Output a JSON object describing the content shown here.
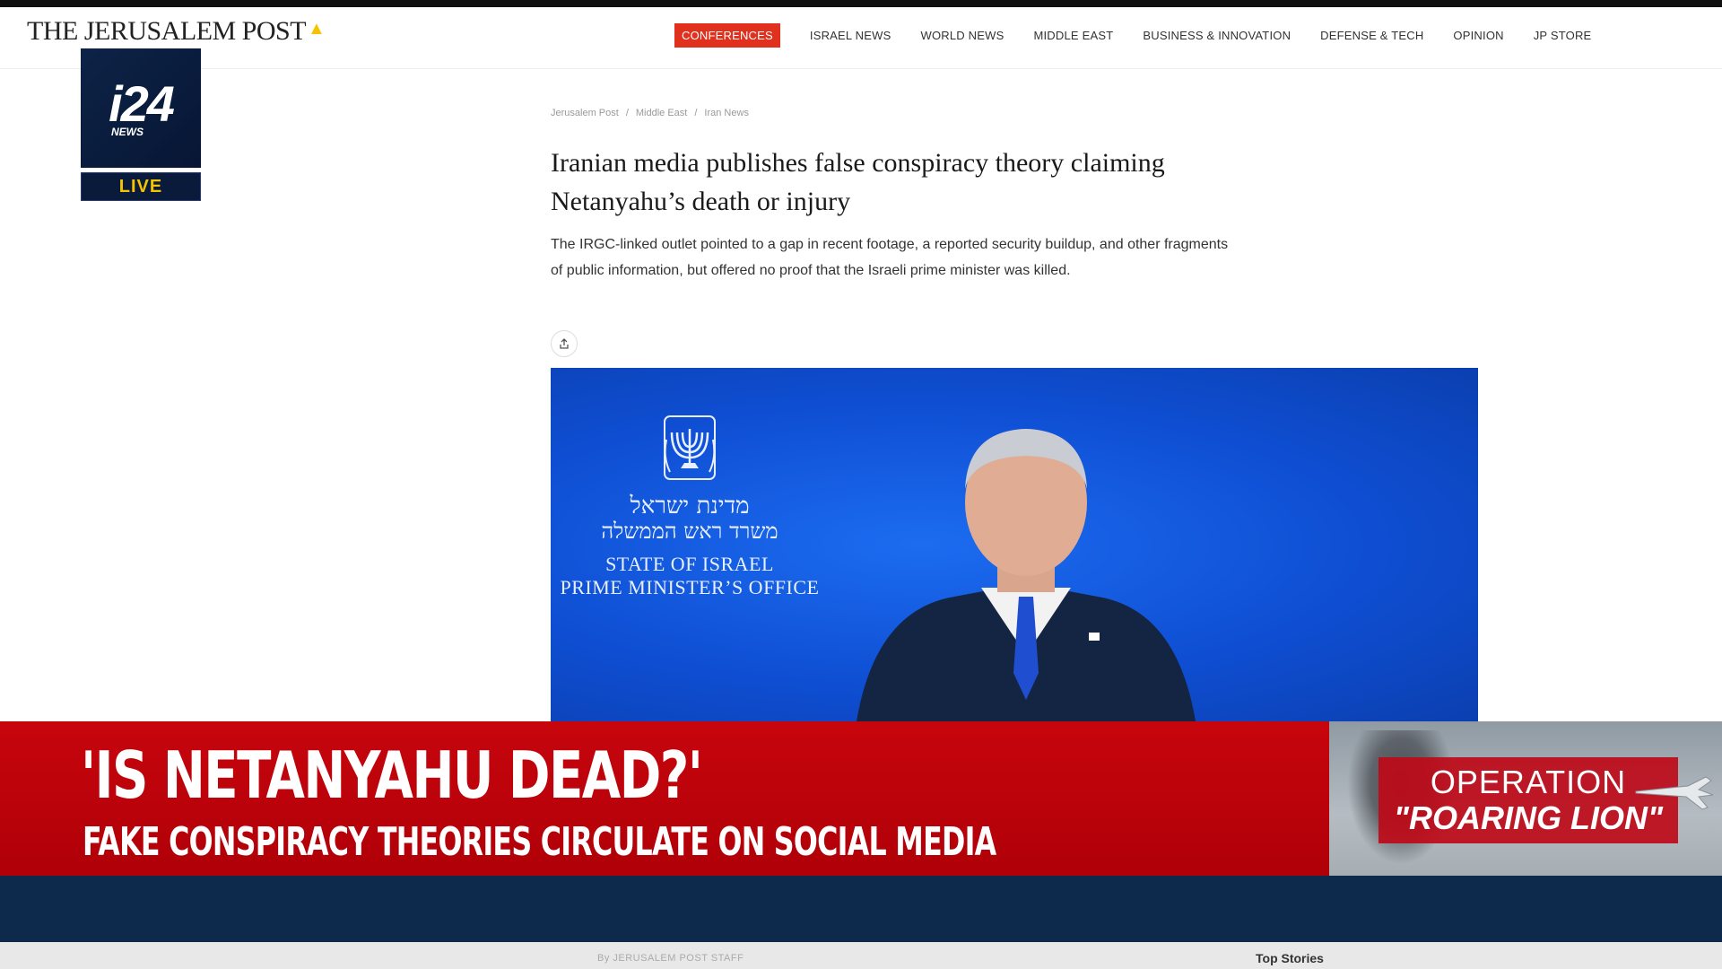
{
  "site": {
    "logo": "THE JERUSALEM POST",
    "nav": [
      "CONFERENCES",
      "ISRAEL NEWS",
      "WORLD NEWS",
      "MIDDLE EAST",
      "BUSINESS & INNOVATION",
      "DEFENSE & TECH",
      "OPINION",
      "JP STORE"
    ]
  },
  "broadcaster": {
    "logo": "i24",
    "logo_sub": "NEWS",
    "live_label": "LIVE"
  },
  "article": {
    "breadcrumb": [
      "Jerusalem Post",
      "Middle East",
      "Iran News"
    ],
    "headline": "Iranian media publishes false conspiracy theory claiming Netanyahu’s death or injury",
    "subhead": "The IRGC-linked outlet pointed to a gap in recent footage, a reported security buildup, and other fragments of public information, but offered no proof that the Israeli prime minister was killed.",
    "share_icon": "share-icon",
    "image": {
      "hebrew_line1": "מדינת ישראל",
      "hebrew_line2": "משרד ראש הממשלה",
      "english_line1": "STATE OF ISRAEL",
      "english_line2": "PRIME MINISTER’S OFFICE"
    }
  },
  "lower_third": {
    "title": "'IS NETANYAHU DEAD?'",
    "subtitle": "FAKE CONSPIRACY THEORIES CIRCULATE ON SOCIAL MEDIA"
  },
  "operation": {
    "line1": "OPERATION",
    "line2": "\"ROARING LION\""
  },
  "footer": {
    "byline": "By JERUSALEM POST STAFF",
    "top_stories": "Top Stories"
  },
  "colors": {
    "nav_accent": "#e0301e",
    "lower_third_red": "#c7050d",
    "hero_blue": "#1c6cf0",
    "bar_navy": "#0d2a4c",
    "live_yellow": "#f5c400"
  }
}
